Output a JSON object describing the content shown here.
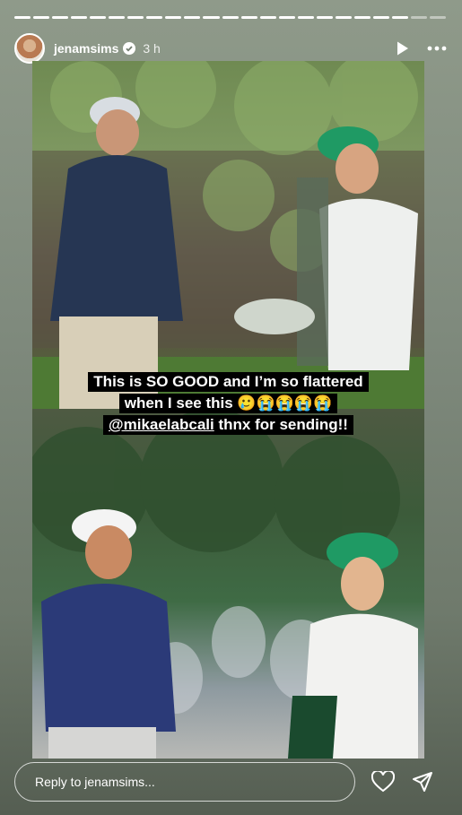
{
  "header": {
    "username": "jenamsims",
    "time": "3 h",
    "icons": [
      "play-icon",
      "more-icon",
      "verified-icon"
    ]
  },
  "progress": {
    "segments_total": 23,
    "segments_done": 21
  },
  "caption": {
    "line1": "This is SO GOOD and I’m so flattered",
    "line2": "when I see this 🥲😭😭😭😭",
    "mention": "@mikaelabcali",
    "line3_rest": " thnx for sending!!"
  },
  "footer": {
    "reply_placeholder": "Reply to jenamsims...",
    "icons": [
      "heart-icon",
      "share-icon"
    ]
  }
}
